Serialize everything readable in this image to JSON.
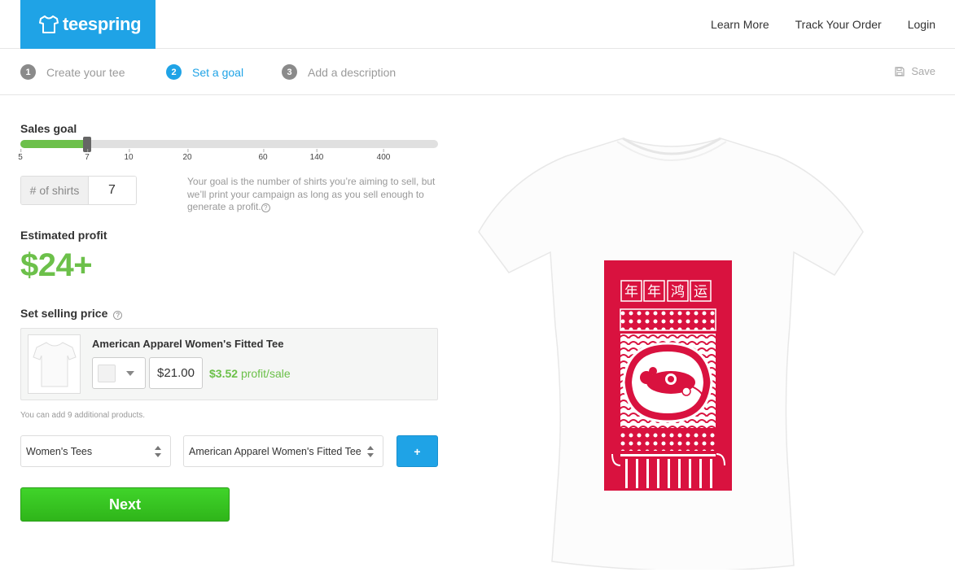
{
  "brand": {
    "name": "teespring",
    "color": "#1fa3e6"
  },
  "nav": {
    "learn_more": "Learn More",
    "track_order": "Track Your Order",
    "login": "Login"
  },
  "steps": [
    {
      "num": "1",
      "label": "Create your tee"
    },
    {
      "num": "2",
      "label": "Set a goal"
    },
    {
      "num": "3",
      "label": "Add a description"
    }
  ],
  "save_label": "Save",
  "sales_goal": {
    "label": "Sales goal",
    "ticks": [
      "5",
      "7",
      "10",
      "20",
      "60",
      "140",
      "400"
    ],
    "current": 7,
    "fill_percent": 16
  },
  "shirts": {
    "label": "# of shirts",
    "value": "7"
  },
  "goal_help": "Your goal is the number of shirts you’re aiming to sell, but we’ll print your campaign as long as you sell enough to generate a profit.",
  "estimated_profit": {
    "label": "Estimated profit",
    "value": "$24+"
  },
  "selling_price": {
    "label": "Set selling price",
    "product_name": "American Apparel Women's Fitted Tee",
    "price": "$21.00",
    "profit_amount": "$3.52",
    "profit_suffix": "profit/sale"
  },
  "add_note": "You can add 9 additional products.",
  "category_select": "Women's Tees",
  "product_select": "American Apparel Women's Fitted Tee",
  "plus_label": "+",
  "next_label": "Next",
  "design": {
    "characters": [
      "年",
      "年",
      "鸿",
      "运"
    ],
    "color": "#d9123f"
  },
  "colors": {
    "accent": "#1fa3e6",
    "profit": "#6cc04a",
    "next": "#36c11f"
  }
}
